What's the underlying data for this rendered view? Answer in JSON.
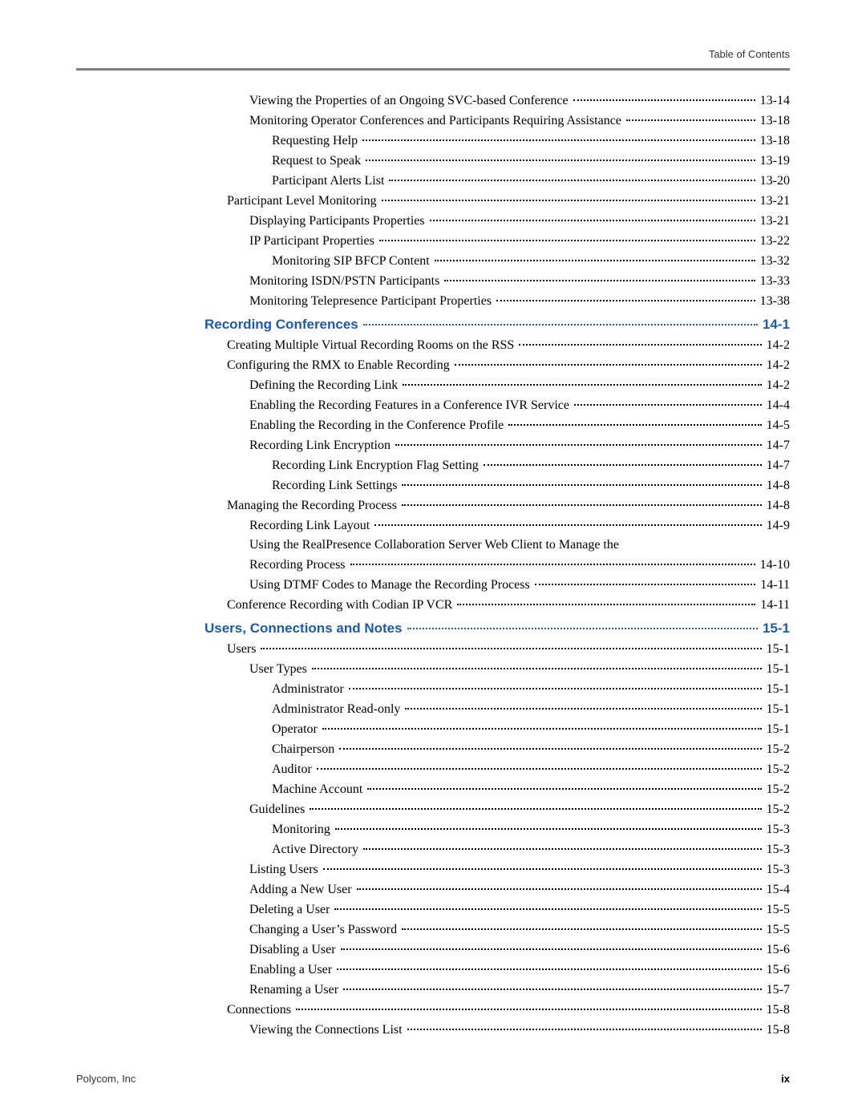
{
  "header_right": "Table of Contents",
  "footer_left": "Polycom, Inc",
  "footer_right": "ix",
  "entries": [
    {
      "level": 2,
      "chapter": false,
      "label": "Viewing the Properties of an Ongoing SVC-based Conference",
      "page": "13-14"
    },
    {
      "level": 2,
      "chapter": false,
      "label": "Monitoring Operator Conferences and Participants Requiring Assistance",
      "page": "13-18"
    },
    {
      "level": 3,
      "chapter": false,
      "label": "Requesting Help",
      "page": "13-18"
    },
    {
      "level": 3,
      "chapter": false,
      "label": "Request to Speak",
      "page": "13-19"
    },
    {
      "level": 3,
      "chapter": false,
      "label": "Participant Alerts List",
      "page": "13-20"
    },
    {
      "level": 1,
      "chapter": false,
      "label": "Participant Level Monitoring",
      "page": "13-21"
    },
    {
      "level": 2,
      "chapter": false,
      "label": "Displaying Participants Properties",
      "page": "13-21"
    },
    {
      "level": 2,
      "chapter": false,
      "label": "IP Participant Properties",
      "page": "13-22"
    },
    {
      "level": 3,
      "chapter": false,
      "label": "Monitoring SIP BFCP Content",
      "page": "13-32"
    },
    {
      "level": 2,
      "chapter": false,
      "label": "Monitoring ISDN/PSTN Participants",
      "page": "13-33"
    },
    {
      "level": 2,
      "chapter": false,
      "label": "Monitoring Telepresence Participant Properties",
      "page": "13-38"
    },
    {
      "level": 0,
      "chapter": true,
      "label": "Recording Conferences",
      "page": "14-1"
    },
    {
      "level": 1,
      "chapter": false,
      "label": "Creating Multiple Virtual Recording Rooms on the RSS",
      "page": "14-2"
    },
    {
      "level": 1,
      "chapter": false,
      "label": "Configuring the RMX to Enable Recording",
      "page": "14-2"
    },
    {
      "level": 2,
      "chapter": false,
      "label": "Defining the Recording Link",
      "page": "14-2"
    },
    {
      "level": 2,
      "chapter": false,
      "label": "Enabling the Recording Features in a Conference IVR Service",
      "page": "14-4"
    },
    {
      "level": 2,
      "chapter": false,
      "label": "Enabling the Recording in the Conference Profile",
      "page": "14-5"
    },
    {
      "level": 2,
      "chapter": false,
      "label": "Recording Link Encryption",
      "page": "14-7"
    },
    {
      "level": 3,
      "chapter": false,
      "label": "Recording Link Encryption Flag Setting",
      "page": "14-7"
    },
    {
      "level": 3,
      "chapter": false,
      "label": "Recording Link Settings",
      "page": "14-8"
    },
    {
      "level": 1,
      "chapter": false,
      "label": "Managing the Recording Process",
      "page": "14-8"
    },
    {
      "level": 2,
      "chapter": false,
      "label": "Recording Link Layout",
      "page": "14-9"
    },
    {
      "level": 2,
      "chapter": false,
      "label": "Using the RealPresence Collaboration Server Web Client to Manage the Recording Process",
      "page": "14-10",
      "wrap": true
    },
    {
      "level": 2,
      "chapter": false,
      "label": "Using DTMF Codes to Manage the Recording Process",
      "page": "14-11"
    },
    {
      "level": 1,
      "chapter": false,
      "label": "Conference Recording with Codian IP VCR",
      "page": "14-11"
    },
    {
      "level": 0,
      "chapter": true,
      "label": "Users, Connections and Notes",
      "page": "15-1"
    },
    {
      "level": 1,
      "chapter": false,
      "label": "Users",
      "page": "15-1"
    },
    {
      "level": 2,
      "chapter": false,
      "label": "User Types",
      "page": "15-1"
    },
    {
      "level": 3,
      "chapter": false,
      "label": "Administrator",
      "page": "15-1"
    },
    {
      "level": 3,
      "chapter": false,
      "label": "Administrator Read-only",
      "page": "15-1"
    },
    {
      "level": 3,
      "chapter": false,
      "label": "Operator",
      "page": "15-1"
    },
    {
      "level": 3,
      "chapter": false,
      "label": "Chairperson",
      "page": "15-2"
    },
    {
      "level": 3,
      "chapter": false,
      "label": "Auditor",
      "page": "15-2"
    },
    {
      "level": 3,
      "chapter": false,
      "label": "Machine Account",
      "page": "15-2"
    },
    {
      "level": 2,
      "chapter": false,
      "label": "Guidelines",
      "page": "15-2"
    },
    {
      "level": 3,
      "chapter": false,
      "label": "Monitoring",
      "page": "15-3"
    },
    {
      "level": 3,
      "chapter": false,
      "label": "Active Directory",
      "page": "15-3"
    },
    {
      "level": 2,
      "chapter": false,
      "label": "Listing Users",
      "page": "15-3"
    },
    {
      "level": 2,
      "chapter": false,
      "label": "Adding a New User",
      "page": "15-4"
    },
    {
      "level": 2,
      "chapter": false,
      "label": "Deleting a User",
      "page": "15-5"
    },
    {
      "level": 2,
      "chapter": false,
      "label": "Changing a User’s Password",
      "page": "15-5"
    },
    {
      "level": 2,
      "chapter": false,
      "label": "Disabling a User",
      "page": "15-6"
    },
    {
      "level": 2,
      "chapter": false,
      "label": "Enabling a User",
      "page": "15-6"
    },
    {
      "level": 2,
      "chapter": false,
      "label": "Renaming a User",
      "page": "15-7"
    },
    {
      "level": 1,
      "chapter": false,
      "label": "Connections",
      "page": "15-8"
    },
    {
      "level": 2,
      "chapter": false,
      "label": "Viewing the Connections List",
      "page": "15-8"
    }
  ]
}
